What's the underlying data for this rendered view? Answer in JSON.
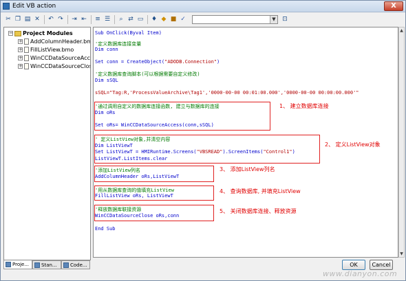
{
  "window": {
    "title": "Edit VB action",
    "close_label": "X"
  },
  "toolbar": {
    "icons": [
      "cut-icon",
      "copy-icon",
      "paste-icon",
      "undo-icon",
      "redo-icon",
      "indent-icon",
      "outdent-icon",
      "comment-icon",
      "uncomment-icon",
      "find-icon",
      "replace-icon",
      "bookmark-icon",
      "tag-icon",
      "script-icon",
      "check-icon",
      "tag-selection-icon"
    ],
    "combo_value": ""
  },
  "tree": {
    "root": "Project Modules",
    "items": [
      "AddColumnHeader.bm",
      "FillListView.bmo",
      "WinCCDataSourceAcc",
      "WinCCDataSourceClos"
    ]
  },
  "left_tabs": [
    "Proje...",
    "Stan...",
    "Code..."
  ],
  "code": {
    "sub": "Sub OnClick(Byval Item)",
    "c1": "'定义数据库连接变量",
    "dim_conn": "Dim conn",
    "set_conn_a": "Set conn = CreateObject(",
    "set_conn_s": "\"ADODB.Connection\"",
    "set_conn_b": ")",
    "c2": "'定义数据库查询脚本(可以根据需要自定义修改)",
    "dim_sql": "Dim sSQL",
    "ssql": "sSQL=\"Tag:R,'ProcessValueArchive\\Tag1','0000-00-00 00:01:00.000','0000-00-00 00:00:00.000'\"",
    "c3": "'通过调用自定义的数据库连接函数, 建立与数据库的连接",
    "dim_ors": "Dim oRs",
    "set_ors": "Set oRs= WinCCDataSourceAccess(conn,sSQL)",
    "c4": "' 定义ListView对象,并清空内容",
    "dim_lv": "Dim ListViewT",
    "set_lv_a": "Set ListViewT = HMIRuntime.Screens(",
    "set_lv_s1": "\"VBSREAD\"",
    "set_lv_b": ").ScreenItems(",
    "set_lv_s2": "\"Control1\"",
    "set_lv_c": ")",
    "lv_clear": "ListViewT.ListItems.clear",
    "c5": "'添加ListView列名",
    "add_col": "AddColumnHeader oRs,ListViewT",
    "c6": "'用从数据库查询的值填充ListView",
    "fill": "FillListView oRs, ListViewT",
    "c7": "'释放数据库联接资源",
    "close": "WinCCDataSourceClose oRs,conn",
    "end": "End Sub"
  },
  "annotations": [
    "1、 建立数据库连接",
    "2、 定义ListView对象",
    "3、 添加ListView列名",
    "4、 查询数据库, 并填充ListView",
    "5、 关闭数据库连接、释放资源"
  ],
  "buttons": {
    "ok": "OK",
    "cancel": "Cancel"
  },
  "watermark": "www.dianyon.com",
  "colors": {
    "keyword": "#0000cc",
    "comment": "#007a00",
    "string": "#b00000",
    "annotation": "#e00000"
  }
}
